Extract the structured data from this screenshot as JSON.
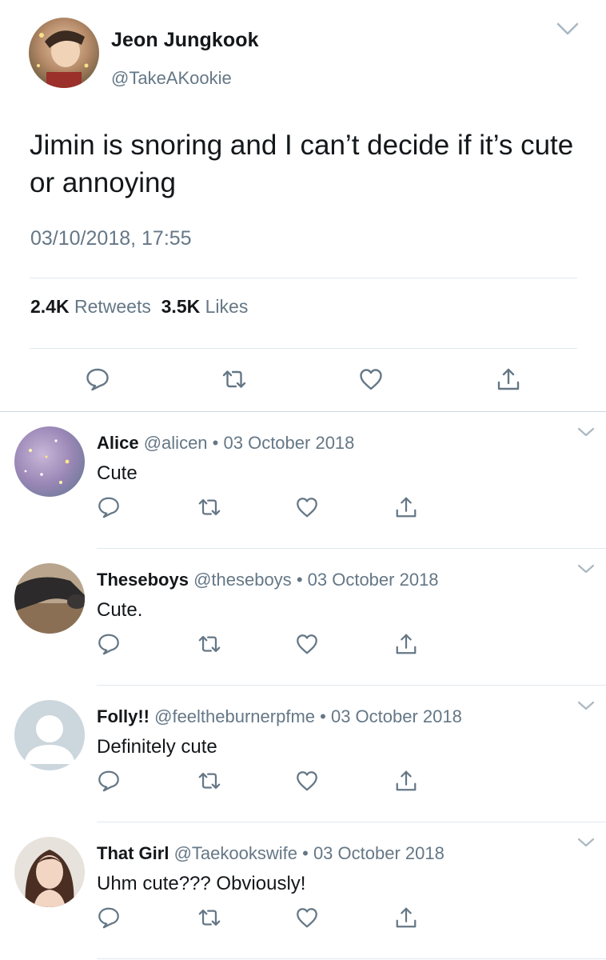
{
  "tweet": {
    "name": "Jeon Jungkook",
    "handle": "@TakeAKookie",
    "text": "Jimin is snoring and I can’t decide if it’s cute or annoying",
    "date": "03/10/2018, 17:55",
    "retweets_count": "2.4K",
    "retweets_label": "Retweets",
    "likes_count": "3.5K",
    "likes_label": "Likes"
  },
  "replies": [
    {
      "name": "Alice",
      "handle": "@alicen",
      "sep": "•",
      "date": "03 October 2018",
      "text": "Cute"
    },
    {
      "name": "Theseboys",
      "handle": "@theseboys",
      "sep": "•",
      "date": "03 October 2018",
      "text": "Cute."
    },
    {
      "name": "Folly!!",
      "handle": "@feeltheburnerpfme",
      "sep": "•",
      "date": "03 October 2018",
      "text": "Definitely cute"
    },
    {
      "name": "That Girl",
      "handle": "@Taekookswife",
      "sep": "•",
      "date": "03 October 2018",
      "text": "Uhm cute??? Obviously!"
    }
  ],
  "icons": [
    "reply-icon",
    "retweet-icon",
    "like-icon",
    "share-icon",
    "chevron-down-icon"
  ],
  "colors": {
    "text": "#14171a",
    "muted": "#657786",
    "divider": "#e1e8ed",
    "icon": "#657786"
  }
}
